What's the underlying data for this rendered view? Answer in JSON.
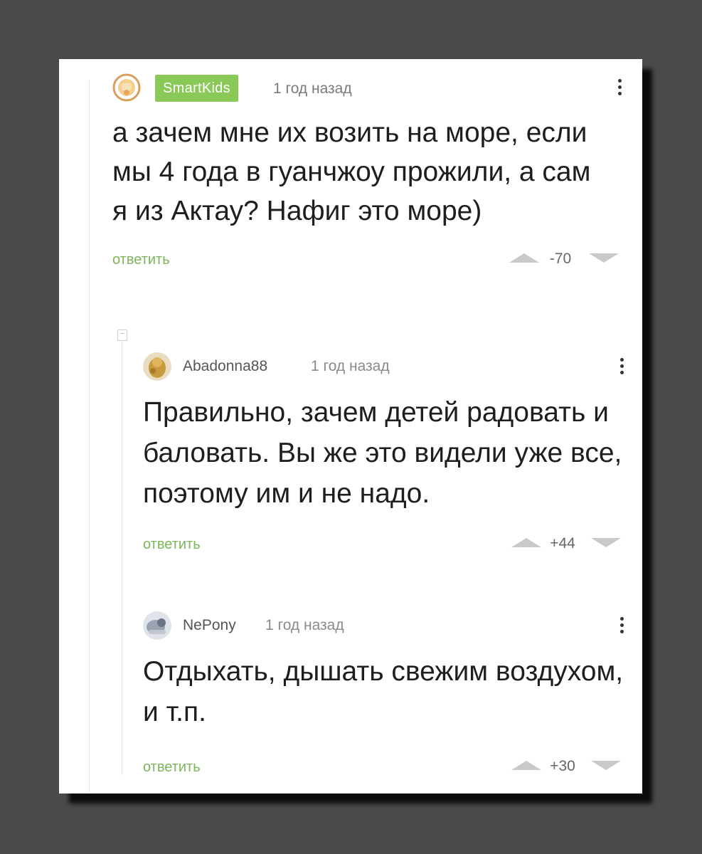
{
  "comments": [
    {
      "author": "SmartKids",
      "time": "1 год назад",
      "text": "а зачем мне их возить на море, если мы 4 года в гуанчжоу прожили, а сам я из Актау? Нафиг это море)",
      "reply_label": "ответить",
      "rating": "-70"
    },
    {
      "author": "Abadonna88",
      "time": "1 год назад",
      "text": "Правильно, зачем детей радовать и баловать. Вы же это видели уже все, поэтому им и не надо.",
      "reply_label": "ответить",
      "rating": "+44"
    },
    {
      "author": "NePony",
      "time": "1 год назад",
      "text": "Отдыхать, дышать свежим воздухом, и т.п.",
      "reply_label": "ответить",
      "rating": "+30"
    }
  ],
  "colors": {
    "accent_green": "#8ac858",
    "reply_green": "#7cb65a",
    "vote_gray": "#c9c9c9"
  },
  "icons": {
    "menu": "kebab-menu-icon",
    "upvote": "upvote-arrow-icon",
    "downvote": "downvote-arrow-icon",
    "collapse": "collapse-thread-icon"
  }
}
